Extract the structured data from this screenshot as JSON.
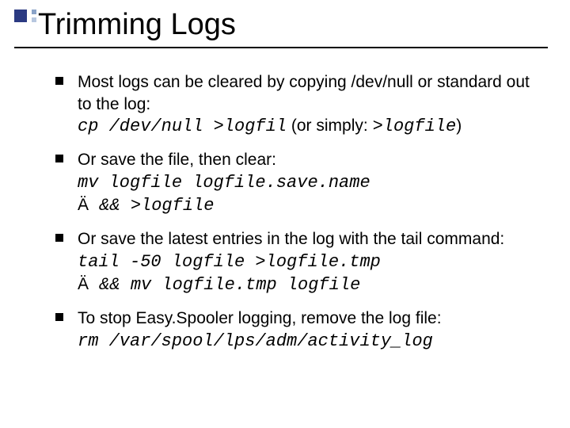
{
  "title": "Trimming Logs",
  "bullets": [
    {
      "text1": "Most logs can be cleared by copying /dev/null or standard out to the log:",
      "cmd1_a": "cp /dev/null >logfil",
      "cmd1_mid": " (or simply: ",
      "cmd1_b": ">logfile",
      "cmd1_end": ")"
    },
    {
      "text2": "Or save the file, then clear:",
      "cmd2_a": "mv logfile logfile.save.name",
      "cmd2_b": " && >logfile"
    },
    {
      "text3": "Or save the latest entries in the log with the tail command:",
      "cmd3_a": "tail -50 logfile >logfile.tmp",
      "cmd3_b": " && mv logfile.tmp logfile"
    },
    {
      "text4": "To stop Easy.Spooler logging, remove the log file:",
      "cmd4": " rm /var/spool/lps/adm/activity_log"
    }
  ],
  "arrow": "Ä"
}
